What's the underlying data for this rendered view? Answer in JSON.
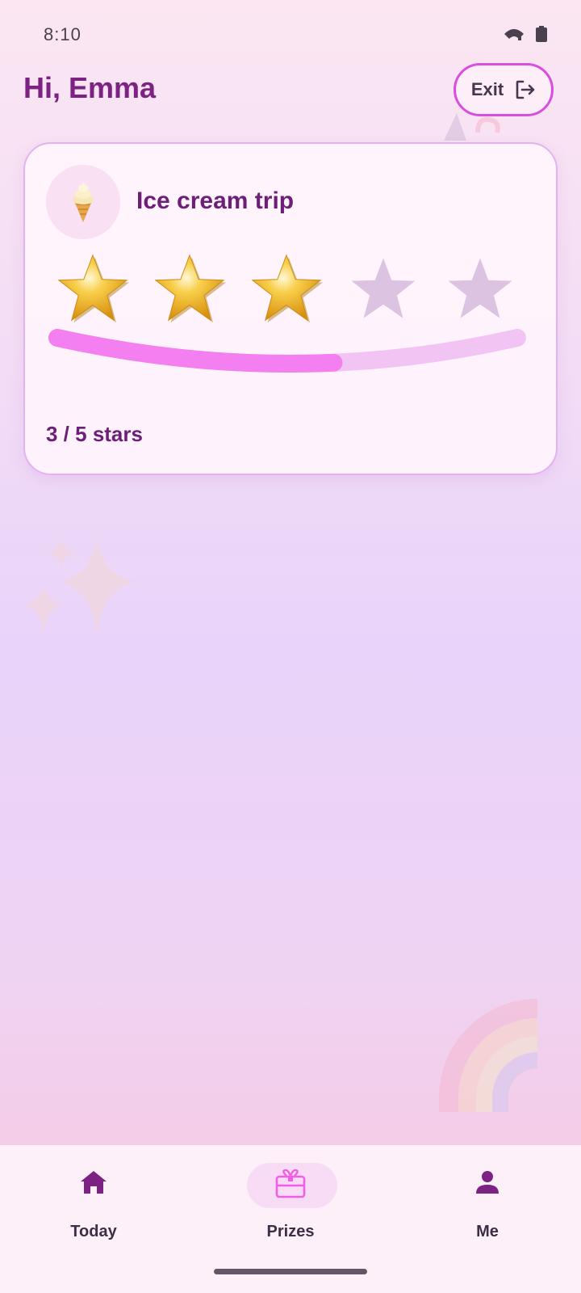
{
  "status_bar": {
    "time": "8:10",
    "icons": [
      "signal-icon",
      "battery-icon"
    ]
  },
  "header": {
    "greeting": "Hi, Emma",
    "exit_label": "Exit",
    "exit_icon": "logout-icon"
  },
  "prize_card": {
    "name": "Ice cream trip",
    "icon": "ice-cream-icon",
    "stars_earned": 3,
    "stars_total": 5,
    "progress_fraction": 0.6,
    "stars_text": "3 / 5 stars"
  },
  "bottom_nav": {
    "items": [
      {
        "label": "Today",
        "icon": "home-icon",
        "active": false
      },
      {
        "label": "Prizes",
        "icon": "gift-icon",
        "active": true
      },
      {
        "label": "Me",
        "icon": "person-icon",
        "active": false
      }
    ]
  },
  "colors": {
    "accent": "#d84ee0",
    "title": "#7b2283",
    "progress_fill": "#f47ff0",
    "progress_track": "#f2c4f4",
    "star_filled": "#f2b423",
    "star_empty": "#dcc3e2"
  }
}
